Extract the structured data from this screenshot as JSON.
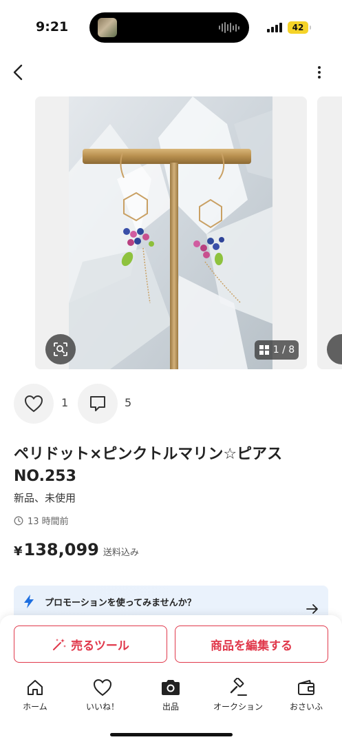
{
  "status_bar": {
    "time": "9:21",
    "battery": "42"
  },
  "header": {
    "back_icon": "chevron-left-icon",
    "more_icon": "more-vertical-icon"
  },
  "gallery": {
    "counter": "1 / 8",
    "lens_icon": "image-search-icon",
    "grid_icon": "grid-icon"
  },
  "reactions": {
    "likes": "1",
    "comments": "5"
  },
  "item": {
    "title": "ペリドット×ピンクトルマリン☆ピアス NO.253",
    "condition": "新品、未使用",
    "posted": "13 時間前",
    "currency": "¥",
    "price": "138,099",
    "shipping": "送料込み"
  },
  "promo": {
    "text": "プロモーションを使ってみませんか？",
    "icon": "lightning-icon"
  },
  "actions": {
    "sell_tool": "売るツール",
    "edit_item": "商品を編集する"
  },
  "tabbar": {
    "tabs": [
      {
        "label": "ホーム",
        "icon": "home-icon"
      },
      {
        "label": "いいね！",
        "icon": "heart-icon"
      },
      {
        "label": "出品",
        "icon": "camera-icon"
      },
      {
        "label": "オークション",
        "icon": "gavel-icon"
      },
      {
        "label": "おさいふ",
        "icon": "wallet-icon"
      }
    ]
  },
  "colors": {
    "accent": "#e0384b",
    "promo_bg": "#e9f1fb",
    "bolt": "#1e6fe0"
  }
}
